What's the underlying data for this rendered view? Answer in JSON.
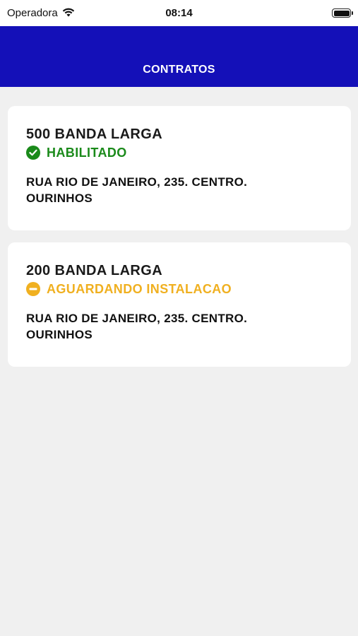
{
  "status_bar": {
    "carrier": "Operadora",
    "time": "08:14",
    "wifi_icon": "wifi-icon",
    "battery_icon": "battery-icon"
  },
  "header": {
    "title": "CONTRATOS"
  },
  "contracts": [
    {
      "plan": "500 BANDA LARGA",
      "status": "HABILITADO",
      "status_icon": "check-circle-icon",
      "status_color": "#1a8a1a",
      "address_line1": "RUA RIO DE JANEIRO, 235. CENTRO.",
      "address_line2": "OURINHOS"
    },
    {
      "plan": "200 BANDA LARGA",
      "status": "AGUARDANDO INSTALACAO",
      "status_icon": "minus-circle-icon",
      "status_color": "#f0b020",
      "address_line1": "RUA RIO DE JANEIRO, 235. CENTRO.",
      "address_line2": "OURINHOS"
    }
  ],
  "colors": {
    "header_bg": "#1410b8",
    "page_bg": "#f0f0f0",
    "card_bg": "#ffffff"
  }
}
